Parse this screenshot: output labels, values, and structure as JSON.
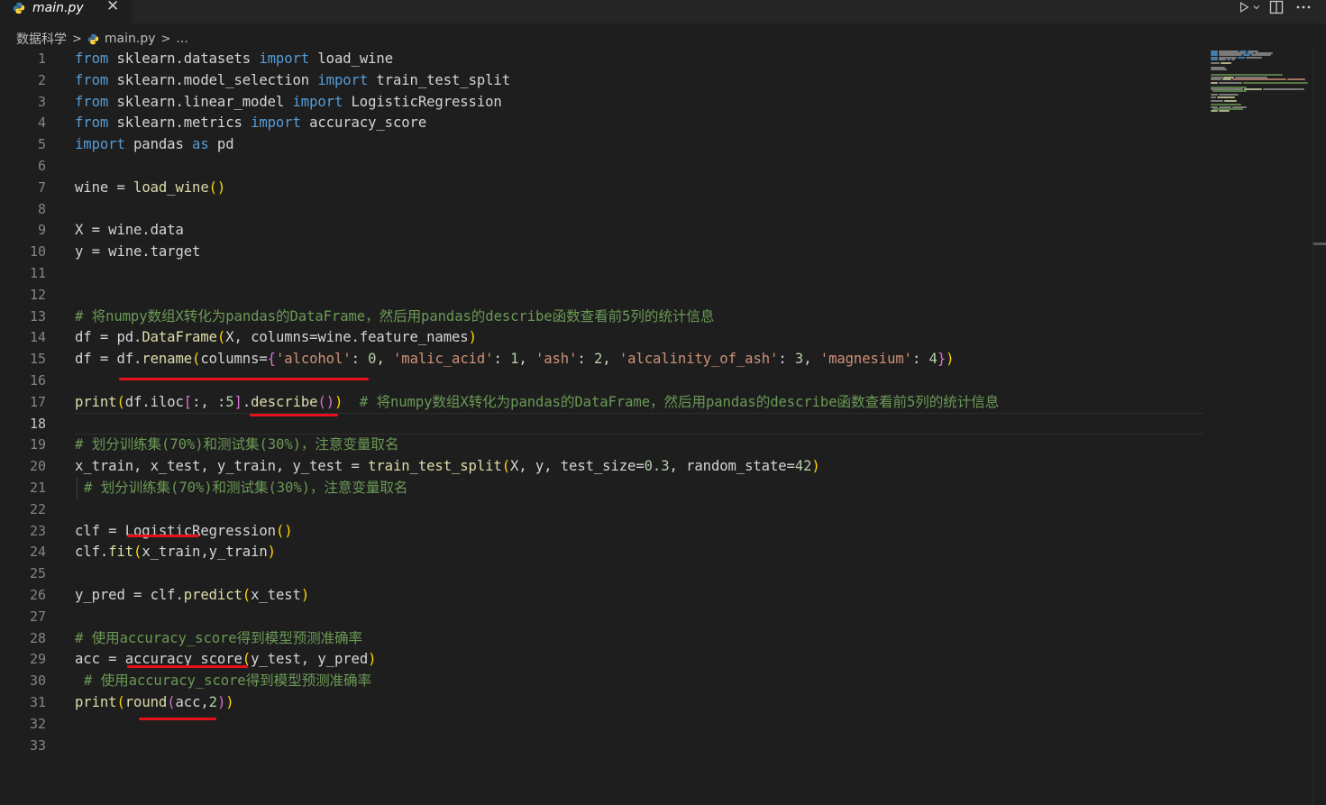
{
  "tab": {
    "title": "main.py",
    "close_glyph": "✕"
  },
  "breadcrumb": {
    "folder": "数据科学",
    "file": "main.py",
    "more": "..."
  },
  "colors": {
    "background": "#1e1e1e",
    "keyword": "#569cd6",
    "function": "#dcdcaa",
    "string": "#ce9178",
    "number": "#b5cea8",
    "comment": "#6a9955",
    "annotation": "#e8101a"
  },
  "icons": {
    "run": "play-icon",
    "run_menu": "chevron-down-icon",
    "split": "split-editor-icon",
    "more": "more-actions-icon",
    "file": "python-file-icon"
  },
  "editor": {
    "active_line": 18,
    "line_numbers": [
      "1",
      "2",
      "3",
      "4",
      "5",
      "6",
      "7",
      "8",
      "9",
      "10",
      "11",
      "12",
      "13",
      "14",
      "15",
      "16",
      "17",
      "18",
      "19",
      "20",
      "21",
      "22",
      "23",
      "24",
      "25",
      "26",
      "27",
      "28",
      "29",
      "30",
      "31",
      "32",
      "33"
    ],
    "lines": {
      "l1": [
        "from",
        " sklearn.datasets ",
        "import",
        " load_wine"
      ],
      "l2": [
        "from",
        " sklearn.model_selection ",
        "import",
        " train_test_split"
      ],
      "l3": [
        "from",
        " sklearn.linear_model ",
        "import",
        " LogisticRegression"
      ],
      "l4": [
        "from",
        " sklearn.metrics ",
        "import",
        " accuracy_score"
      ],
      "l5": [
        "import",
        " pandas ",
        "as",
        " pd"
      ],
      "l7": [
        "wine = ",
        "load_wine",
        "()"
      ],
      "l9": "X = wine.data",
      "l10": "y = wine.target",
      "l13": "# 将numpy数组X转化为pandas的DataFrame，然后用pandas的describe函数查看前5列的统计信息",
      "l14": [
        "df = pd.",
        "DataFrame",
        "(",
        "X, columns=wine.feature_names",
        ")"
      ],
      "l15": [
        "df = df.",
        "rename",
        "(",
        "columns=",
        "{",
        "'alcohol'",
        ": ",
        "0",
        ", ",
        "'malic_acid'",
        ": ",
        "1",
        ", ",
        "'ash'",
        ": ",
        "2",
        ", ",
        "'alcalinity_of_ash'",
        ": ",
        "3",
        ", ",
        "'magnesium'",
        ": ",
        "4",
        "}",
        ")"
      ],
      "l17": [
        "print",
        "(",
        "df.iloc",
        "[",
        ":, :",
        "5",
        "]",
        ".",
        "describe",
        "(",
        ")",
        ")",
        "  # 将numpy数组X转化为pandas的DataFrame，然后用pandas的describe函数查看前5列的统计信息"
      ],
      "l19": "# 划分训练集(70%)和测试集(30%)，注意变量取名",
      "l20": [
        "x_train, x_test, y_train, y_test = ",
        "train_test_split",
        "(",
        "X, y, test_size=",
        "0.3",
        ", random_state=",
        "42",
        ")"
      ],
      "l21": "# 划分训练集(70%)和测试集(30%)，注意变量取名",
      "l23": [
        "clf = ",
        "LogisticRegression",
        "(",
        ")"
      ],
      "l24": [
        "clf.",
        "fit",
        "(",
        "x_train,y_train",
        ")"
      ],
      "l26": [
        "y_pred = clf.",
        "predict",
        "(",
        "x_test",
        ")"
      ],
      "l28": "# 使用accuracy_score得到模型预测准确率",
      "l29": [
        "acc = ",
        "accuracy_score",
        "(",
        "y_test, y_pred",
        ")"
      ],
      "l30": "# 使用accuracy_score得到模型预测准确率",
      "l31": [
        "print",
        "(",
        "round",
        "(",
        "acc,",
        "2",
        ")",
        ")"
      ]
    }
  }
}
